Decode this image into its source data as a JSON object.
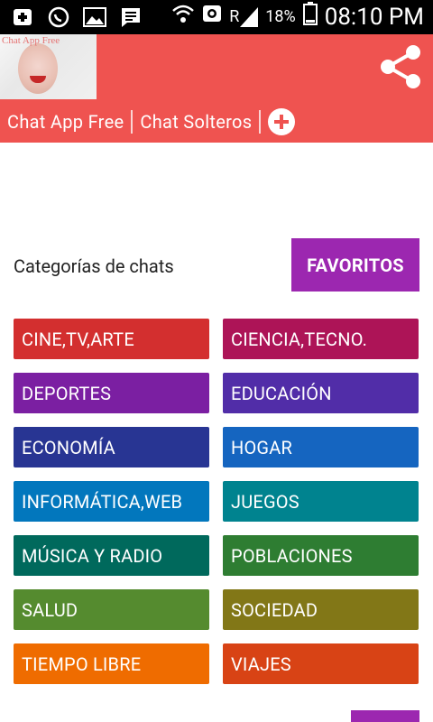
{
  "status_bar": {
    "icons": [
      "add-icon",
      "whatsapp-icon",
      "image-icon",
      "message-icon"
    ],
    "roaming": "R",
    "battery": "18%",
    "time": "08:10 PM"
  },
  "header": {
    "avatar_text": "Chat App Free",
    "tabs": [
      "Chat App Free",
      "Chat Solteros"
    ]
  },
  "main": {
    "categories_label": "Categorías de chats",
    "favorites_button": "FAVORITOS",
    "categories": [
      {
        "label": "CINE,TV,ARTE",
        "color": "#d32f2f"
      },
      {
        "label": "CIENCIA,TECNO.",
        "color": "#ad1457"
      },
      {
        "label": "DEPORTES",
        "color": "#7b1fa2"
      },
      {
        "label": "EDUCACIÓN",
        "color": "#512da8"
      },
      {
        "label": "ECONOMÍA",
        "color": "#283593"
      },
      {
        "label": "HOGAR",
        "color": "#1565c0"
      },
      {
        "label": "INFORMÁTICA,WEB",
        "color": "#0277bd"
      },
      {
        "label": "JUEGOS",
        "color": "#00838f"
      },
      {
        "label": "MÚSICA Y RADIO",
        "color": "#00695c"
      },
      {
        "label": "POBLACIONES",
        "color": "#2e7d32"
      },
      {
        "label": "SALUD",
        "color": "#558b2f"
      },
      {
        "label": "SOCIEDAD",
        "color": "#827717"
      },
      {
        "label": "TIEMPO LIBRE",
        "color": "#ef6c00"
      },
      {
        "label": "VIAJES",
        "color": "#d84315"
      }
    ]
  },
  "colors": {
    "header": "#ef5350",
    "accent": "#9c27b0"
  }
}
